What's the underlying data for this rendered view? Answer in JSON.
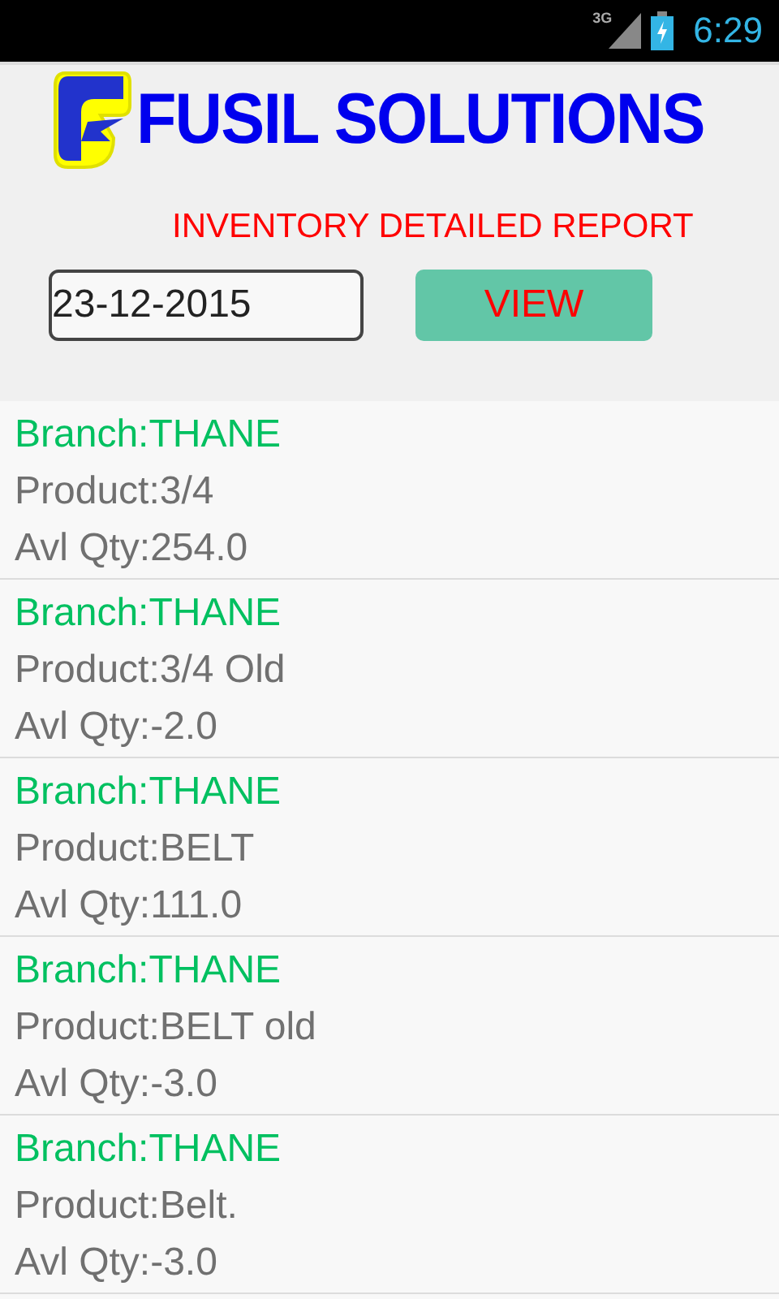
{
  "status_bar": {
    "network": "3G",
    "time": "6:29"
  },
  "header": {
    "brand": "FUSIL SOLUTIONS",
    "report_title": "INVENTORY DETAILED REPORT",
    "date_field": {
      "value": "23-12-2015"
    },
    "view_button": "VIEW"
  },
  "records": [
    {
      "branch": "Branch:THANE",
      "product": "Product:3/4",
      "quantity": "Avl Qty:254.0"
    },
    {
      "branch": "Branch:THANE",
      "product": "Product:3/4 Old",
      "quantity": "Avl Qty:-2.0"
    },
    {
      "branch": "Branch:THANE",
      "product": "Product:BELT",
      "quantity": "Avl Qty:111.0"
    },
    {
      "branch": "Branch:THANE",
      "product": "Product:BELT old",
      "quantity": "Avl Qty:-3.0"
    },
    {
      "branch": "Branch:THANE",
      "product": "Product:Belt.",
      "quantity": "Avl Qty:-3.0"
    }
  ]
}
